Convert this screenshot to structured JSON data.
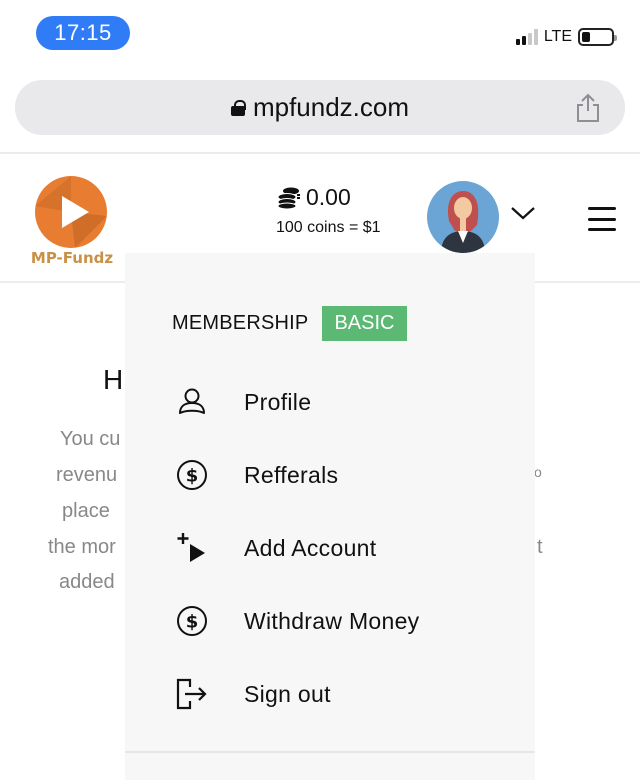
{
  "status_bar": {
    "time": "17:15",
    "network": "LTE",
    "signal_bars_active": 2,
    "signal_bars_total": 4,
    "battery_level_percent": 20,
    "time_pill_color": "#2f7cf6"
  },
  "browser": {
    "url": "mpfundz.com",
    "lock_icon": "lock-icon",
    "share_icon": "share-icon"
  },
  "header": {
    "logo_text": "MP-Fundz",
    "logo_color": "#e87d32",
    "coins": {
      "icon": "coins-icon",
      "balance": "0.00",
      "rate": "100 coins = $1"
    },
    "avatar_alt": "user avatar",
    "menu_icon": "hamburger-icon",
    "chevron_icon": "chevron-down-icon"
  },
  "background_content": {
    "heading_fragment": "H",
    "lines": [
      "You cu",
      "revenu",
      "place ",
      "the mor",
      "added",
      "o",
      "t"
    ]
  },
  "dropdown": {
    "membership_label": "MEMBERSHIP",
    "membership_level": "BASIC",
    "badge_color": "#5bb974",
    "items": [
      {
        "label": "Profile",
        "icon": "user-icon"
      },
      {
        "label": "Refferals",
        "icon": "dollar-circle-icon"
      },
      {
        "label": "Add Account",
        "icon": "add-play-icon"
      },
      {
        "label": "Withdraw Money",
        "icon": "dollar-circle-icon"
      },
      {
        "label": "Sign out",
        "icon": "sign-out-icon"
      }
    ]
  }
}
